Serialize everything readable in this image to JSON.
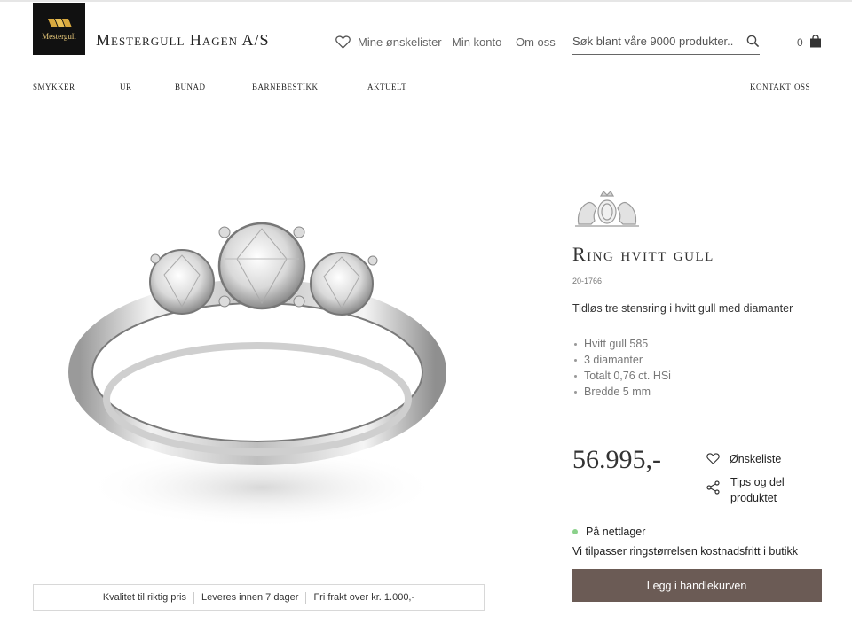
{
  "header": {
    "logo_text": "Mestergull",
    "store_name": "Mestergull Hagen A/S",
    "wishlist_label": "Mine ønskelister",
    "account_label": "Min konto",
    "about_label": "Om oss",
    "search_placeholder": "Søk blant våre 9000 produkter...",
    "cart_count": "0"
  },
  "nav": {
    "items": [
      "Smykker",
      "Ur",
      "Bunad",
      "Barnebestikk",
      "Aktuelt"
    ],
    "contact": "Kontakt oss"
  },
  "info_bar": [
    "Kvalitet til riktig pris",
    "Leveres innen 7 dager",
    "Fri frakt over kr. 1.000,-"
  ],
  "product": {
    "title": "Ring hvitt gull",
    "sku": "20-1766",
    "description": "Tidløs tre stensring i hvitt gull med diamanter",
    "specs": [
      "Hvitt gull 585",
      "3 diamanter",
      "Totalt 0,76 ct. HSi",
      "Bredde 5 mm"
    ],
    "price": "56.995,-",
    "wishlist_label": "Ønskeliste",
    "share_label": "Tips og del produktet",
    "stock_label": "På nettlager",
    "size_note": "Vi tilpasser ringstørrelsen kostnadsfritt i butikk",
    "add_to_cart": "Legg i handlekurven"
  },
  "colors": {
    "button": "#6b5b55",
    "stock": "#8bd18b",
    "logo_gold": "#e8c97a"
  },
  "icons": [
    "heart-icon",
    "search-icon",
    "shopping-bag-icon",
    "crest-icon",
    "share-icon"
  ]
}
